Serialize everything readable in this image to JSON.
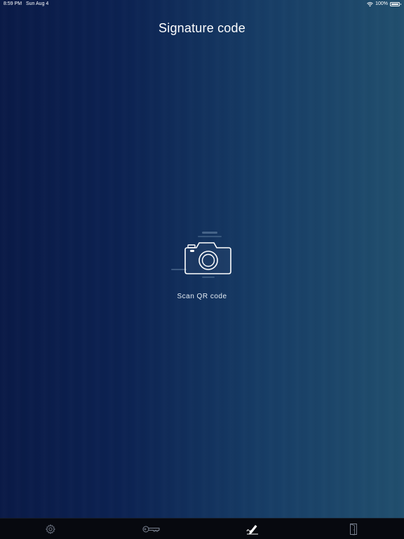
{
  "status_bar": {
    "time": "8:59 PM",
    "date": "Sun Aug 4",
    "battery": "100%"
  },
  "header": {
    "title": "Signature code"
  },
  "main": {
    "scan_label": "Scan QR code",
    "icon": "camera-icon"
  },
  "tab_bar": {
    "tabs": [
      {
        "icon": "gear-icon",
        "active": false
      },
      {
        "icon": "key-icon",
        "active": false
      },
      {
        "icon": "signature-icon",
        "active": true
      },
      {
        "icon": "door-exit-icon",
        "active": false
      }
    ]
  },
  "colors": {
    "background_left": "#0a1a47",
    "background_right": "#214f6e",
    "tab_bar": "#07090f",
    "text": "#ffffff"
  }
}
